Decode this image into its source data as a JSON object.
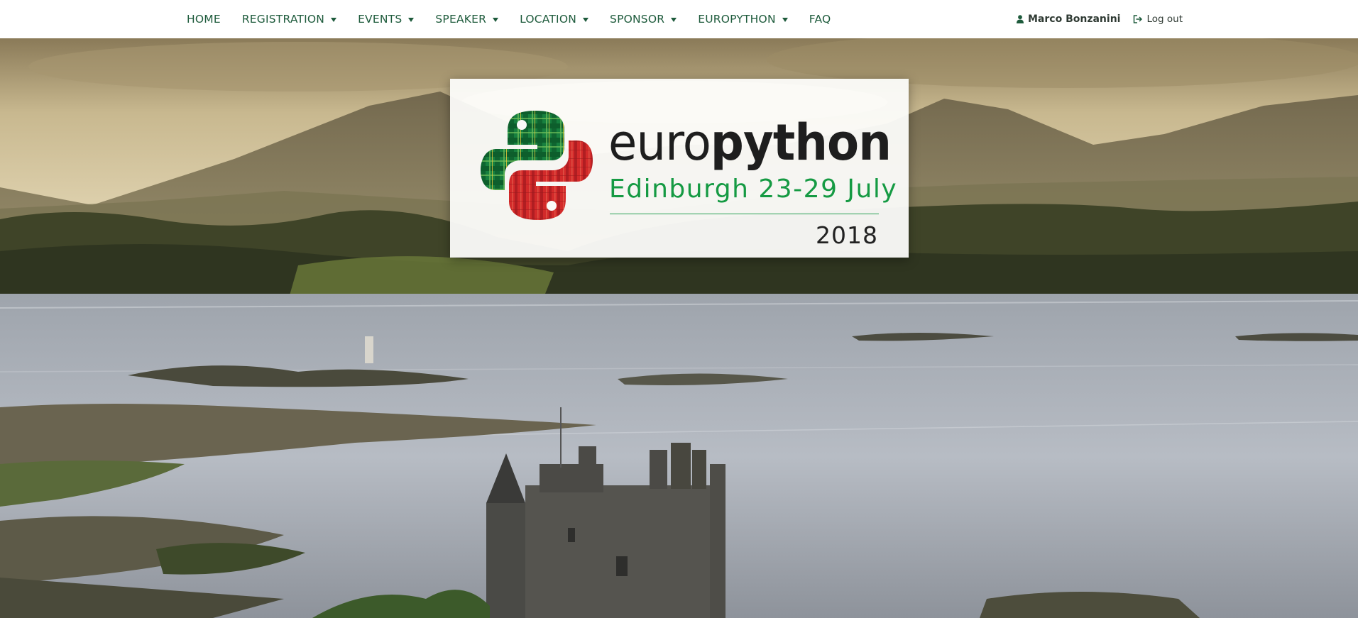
{
  "nav": {
    "items": [
      {
        "label": "HOME",
        "dropdown": false
      },
      {
        "label": "REGISTRATION",
        "dropdown": true
      },
      {
        "label": "EVENTS",
        "dropdown": true
      },
      {
        "label": "SPEAKER",
        "dropdown": true
      },
      {
        "label": "LOCATION",
        "dropdown": true
      },
      {
        "label": "SPONSOR",
        "dropdown": true
      },
      {
        "label": "EUROPYTHON",
        "dropdown": true
      },
      {
        "label": "FAQ",
        "dropdown": false
      }
    ],
    "user_name": "Marco Bonzanini",
    "user_icon": "user-icon",
    "logout_label": "Log out",
    "logout_icon": "sign-out-icon"
  },
  "logo": {
    "wordmark_light": "euro",
    "wordmark_bold": "python",
    "city_dates": "Edinburgh 23-29 July",
    "year": "2018"
  },
  "colors": {
    "nav_text": "#1e5b3c",
    "brand_green": "#159a43",
    "brand_red": "#d32a2a"
  }
}
